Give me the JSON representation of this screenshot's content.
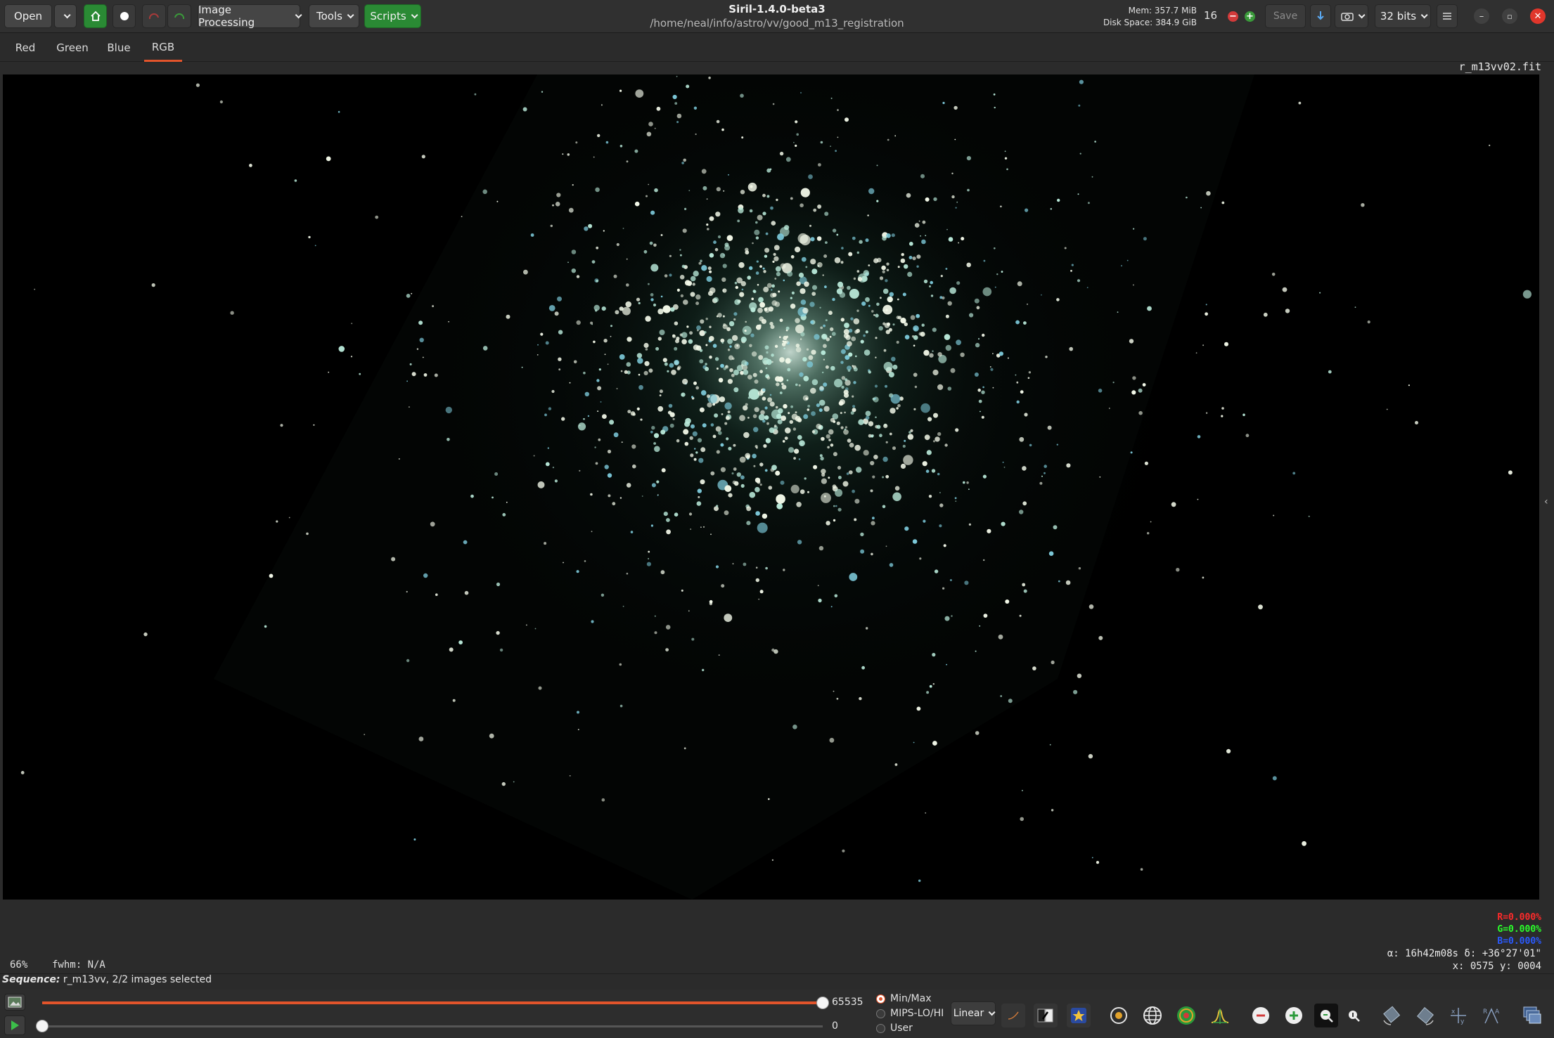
{
  "header": {
    "open_label": "Open",
    "image_processing_label": "Image Processing",
    "tools_label": "Tools",
    "scripts_label": "Scripts",
    "app_title": "Siril-1.4.0-beta3",
    "working_dir": "/home/neal/info/astro/vv/good_m13_registration",
    "memory": "Mem: 357.7 MiB",
    "disk_space": "Disk Space: 384.9 GiB",
    "threads": "16",
    "save_label": "Save",
    "bit_depth": "32 bits"
  },
  "tabs": [
    {
      "label": "Red"
    },
    {
      "label": "Green"
    },
    {
      "label": "Blue"
    },
    {
      "label": "RGB",
      "active": true
    }
  ],
  "image": {
    "filename": "r_m13vv02.fit"
  },
  "status": {
    "zoom": "66%",
    "fwhm": "fwhm: N/A",
    "r_value": "R=0.000%",
    "g_value": "G=0.000%",
    "b_value": "B=0.000%",
    "ra_dec": "α: 16h42m08s δ: +36°27'01\"",
    "xy": "x: 0575 y: 0004"
  },
  "sequence": {
    "label": "Sequence:",
    "text": "r_m13vv, 2/2 images selected"
  },
  "bottom": {
    "max_value": "65535",
    "min_value": "0",
    "high_slider_fraction": 1.0,
    "low_slider_fraction": 0.0,
    "scale_options": [
      "Min/Max",
      "MIPS-LO/HI",
      "User"
    ],
    "selected_scale": "Min/Max",
    "transfer_function": "Linear"
  },
  "colors": {
    "accent": "#e2542b",
    "green_button": "#2a8a34",
    "r_color": "#ff2a2a",
    "g_color": "#2aff2a",
    "b_color": "#2a5aff"
  },
  "icons": {
    "home": "home-icon",
    "record": "record-icon",
    "undo": "undo-icon",
    "redo": "redo-icon",
    "menu": "hamburger-menu-icon"
  }
}
